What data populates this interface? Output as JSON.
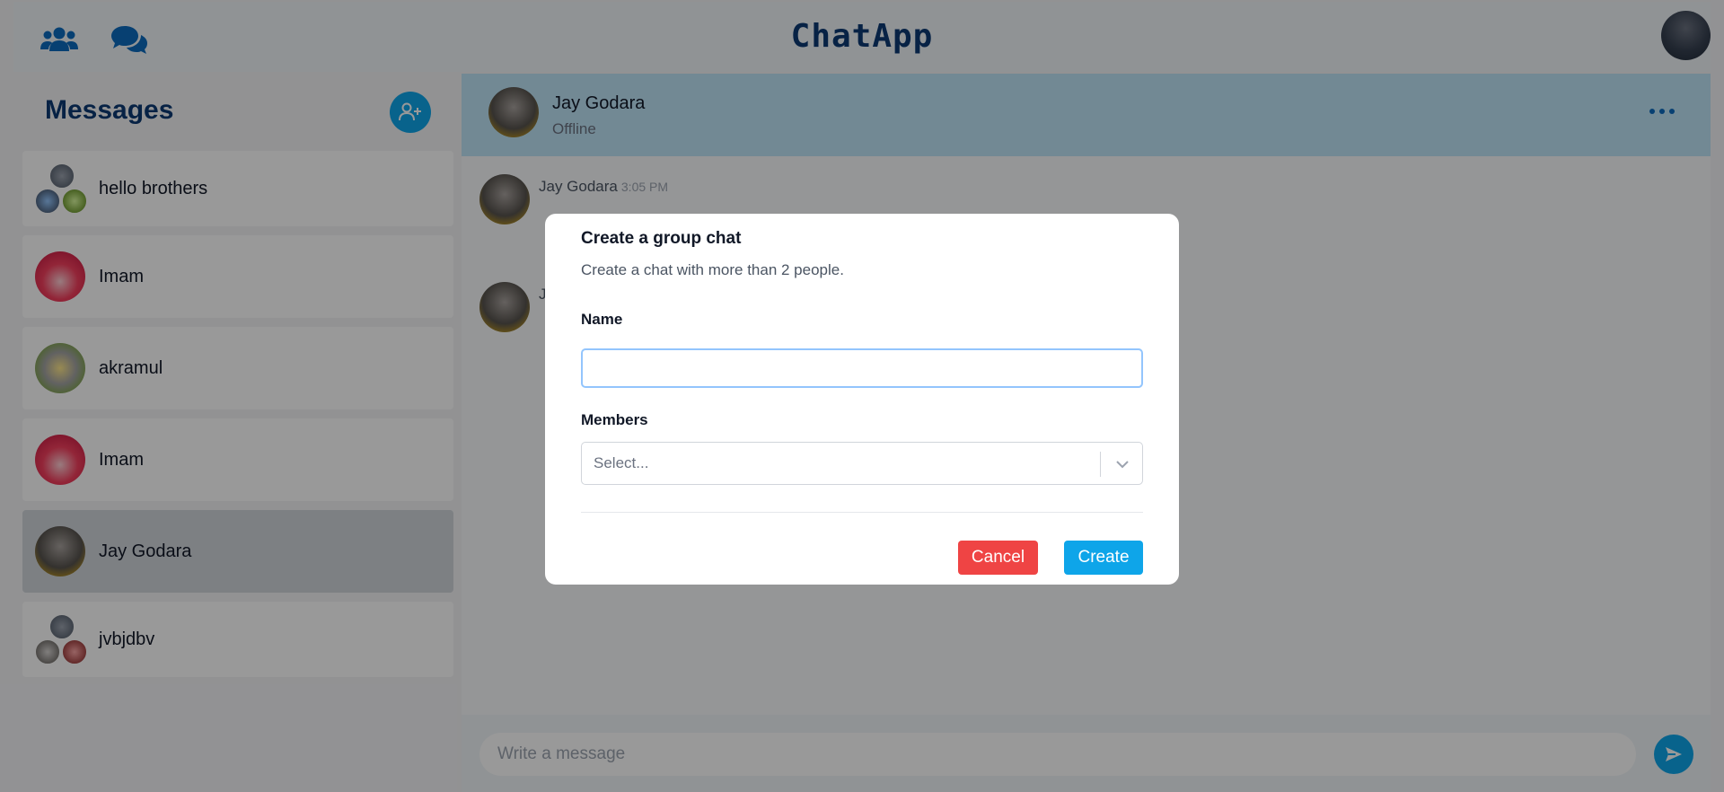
{
  "app": {
    "title": "ChatApp"
  },
  "topbar": {
    "icons": [
      "users-icon",
      "chat-bubbles-icon"
    ]
  },
  "sidebar": {
    "title": "Messages",
    "chats": [
      {
        "name": "hello brothers",
        "type": "group"
      },
      {
        "name": "Imam",
        "type": "single"
      },
      {
        "name": "akramul",
        "type": "single"
      },
      {
        "name": "Imam",
        "type": "single"
      },
      {
        "name": "Jay Godara",
        "type": "single",
        "active": true
      },
      {
        "name": "jvbjdbv",
        "type": "group"
      }
    ]
  },
  "chat": {
    "header": {
      "name": "Jay Godara",
      "status": "Offline"
    },
    "messages": [
      {
        "sender": "Jay Godara",
        "time": "3:05 PM"
      },
      {
        "sender": "J",
        "time": ""
      }
    ],
    "composer": {
      "placeholder": "Write a message"
    }
  },
  "modal": {
    "title": "Create a group chat",
    "description": "Create a chat with more than 2 people.",
    "name_label": "Name",
    "name_value": "",
    "members_label": "Members",
    "members_placeholder": "Select...",
    "cancel_label": "Cancel",
    "create_label": "Create"
  },
  "colors": {
    "brand": "#0c3a73",
    "accent": "#0ea5e9",
    "danger": "#ef4444",
    "header_bg": "#bfe4f7"
  }
}
